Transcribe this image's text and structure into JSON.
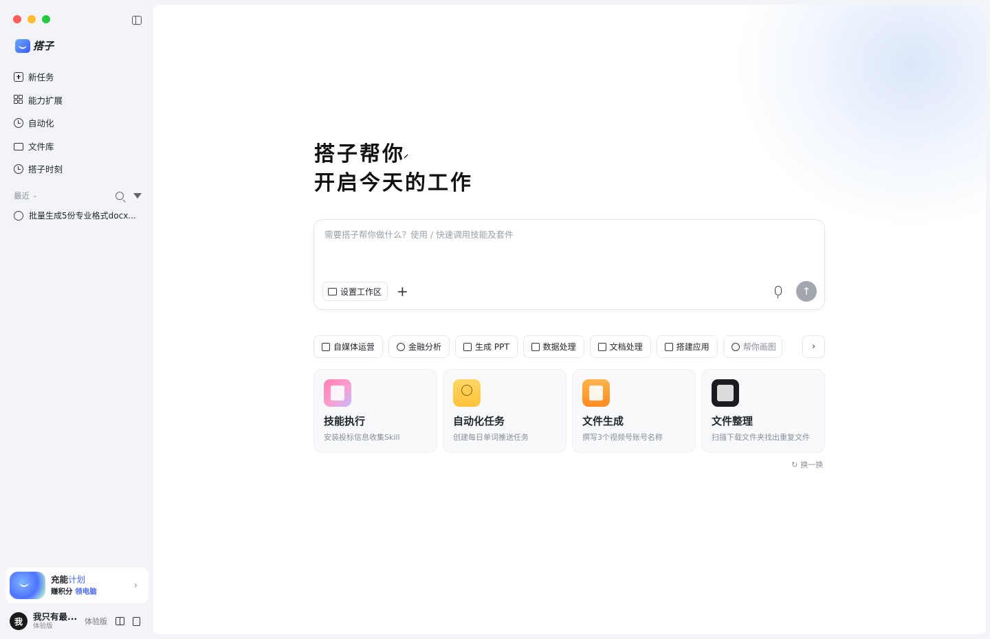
{
  "sidebar": {
    "brand": "搭子",
    "nav": [
      {
        "label": "新任务",
        "icon": "new-task-icon"
      },
      {
        "label": "能力扩展",
        "icon": "extensions-icon"
      },
      {
        "label": "自动化",
        "icon": "automation-clock-icon"
      },
      {
        "label": "文件库",
        "icon": "folder-icon"
      },
      {
        "label": "搭子时刻",
        "icon": "moments-icon"
      }
    ],
    "recent_label": "最近",
    "recent_items": [
      {
        "label": "批量生成5份专业格式docx..."
      }
    ],
    "promo": {
      "title_a": "充能",
      "title_b": "计划",
      "sub_a": "赚积分",
      "sub_b": "领电脑"
    },
    "user": {
      "avatar_text": "我",
      "name": "我只有最...",
      "tier": "体验版",
      "edition": "体验版"
    }
  },
  "main": {
    "headline_line1": "搭子帮你",
    "headline_line2": "开启今天的工作",
    "composer": {
      "placeholder": "需要搭子帮你做什么？使用 / 快速调用技能及套件",
      "workspace_label": "设置工作区",
      "add_symbol": "+"
    },
    "chips": [
      {
        "label": "自媒体运营",
        "icon": "video-icon"
      },
      {
        "label": "金融分析",
        "icon": "target-icon"
      },
      {
        "label": "生成 PPT",
        "icon": "ppt-icon"
      },
      {
        "label": "数据处理",
        "icon": "chart-line-icon"
      },
      {
        "label": "文档处理",
        "icon": "document-icon"
      },
      {
        "label": "搭建应用",
        "icon": "app-window-icon"
      },
      {
        "label": "帮你画图",
        "icon": "palette-icon"
      }
    ],
    "cards": [
      {
        "title": "技能执行",
        "subtitle": "安装投标信息收集Skill",
        "icon": "skill-icon"
      },
      {
        "title": "自动化任务",
        "subtitle": "创建每日单词推送任务",
        "icon": "alarm-clock-icon"
      },
      {
        "title": "文件生成",
        "subtitle": "撰写3个视频号账号名称",
        "icon": "file-generate-icon"
      },
      {
        "title": "文件整理",
        "subtitle": "扫描下载文件夹找出重复文件",
        "icon": "file-organize-icon"
      }
    ],
    "refresh_label": "换一换"
  },
  "colors": {
    "accent": "#4c6bff",
    "sidebar_bg": "#f3f4f7",
    "send_button": "#a2a6ad"
  }
}
